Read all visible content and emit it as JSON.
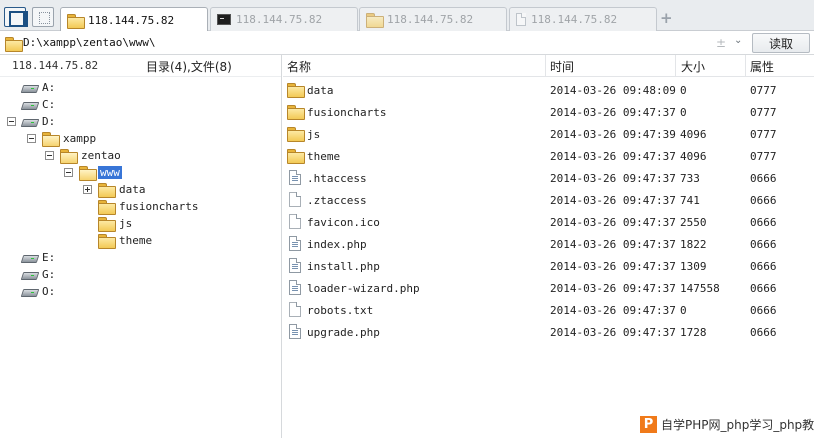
{
  "tabs": [
    {
      "label": "118.144.75.82",
      "icon": "folder-icon",
      "active": true
    },
    {
      "label": "118.144.75.82",
      "icon": "terminal-icon",
      "active": false
    },
    {
      "label": "118.144.75.82",
      "icon": "folder-icon",
      "active": false
    },
    {
      "label": "118.144.75.82",
      "icon": "file-icon",
      "active": false
    }
  ],
  "tab_add": "+",
  "address": {
    "path": "D:\\xampp\\zentao\\www\\",
    "up_glyph": "±",
    "dropdown_glyph": "⌄"
  },
  "read_button": "读取",
  "left": {
    "host": "118.144.75.82",
    "counts": "目录(4),文件(8)",
    "tree": [
      {
        "label": "A:",
        "type": "drive"
      },
      {
        "label": "C:",
        "type": "drive"
      },
      {
        "label": "D:",
        "type": "drive",
        "expanded": true
      },
      {
        "label": "xampp",
        "type": "folder",
        "expanded": true
      },
      {
        "label": "zentao",
        "type": "folder",
        "expanded": true
      },
      {
        "label": "www",
        "type": "folder",
        "expanded": true,
        "selected": true
      },
      {
        "label": "data",
        "type": "folder",
        "expanded": false
      },
      {
        "label": "fusioncharts",
        "type": "folder"
      },
      {
        "label": "js",
        "type": "folder"
      },
      {
        "label": "theme",
        "type": "folder"
      },
      {
        "label": "E:",
        "type": "drive"
      },
      {
        "label": "G:",
        "type": "drive"
      },
      {
        "label": "O:",
        "type": "drive"
      }
    ]
  },
  "columns": {
    "name": "名称",
    "time": "时间",
    "size": "大小",
    "attr": "属性"
  },
  "files": [
    {
      "name": "data",
      "time": "2014-03-26 09:48:09",
      "size": "0",
      "attr": "0777",
      "type": "folder"
    },
    {
      "name": "fusioncharts",
      "time": "2014-03-26 09:47:37",
      "size": "0",
      "attr": "0777",
      "type": "folder"
    },
    {
      "name": "js",
      "time": "2014-03-26 09:47:39",
      "size": "4096",
      "attr": "0777",
      "type": "folder"
    },
    {
      "name": "theme",
      "time": "2014-03-26 09:47:37",
      "size": "4096",
      "attr": "0777",
      "type": "folder"
    },
    {
      "name": ".htaccess",
      "time": "2014-03-26 09:47:37",
      "size": "733",
      "attr": "0666",
      "type": "doc"
    },
    {
      "name": ".ztaccess",
      "time": "2014-03-26 09:47:37",
      "size": "741",
      "attr": "0666",
      "type": "blank"
    },
    {
      "name": "favicon.ico",
      "time": "2014-03-26 09:47:37",
      "size": "2550",
      "attr": "0666",
      "type": "blank"
    },
    {
      "name": "index.php",
      "time": "2014-03-26 09:47:37",
      "size": "1822",
      "attr": "0666",
      "type": "doc"
    },
    {
      "name": "install.php",
      "time": "2014-03-26 09:47:37",
      "size": "1309",
      "attr": "0666",
      "type": "doc"
    },
    {
      "name": "loader-wizard.php",
      "time": "2014-03-26 09:47:37",
      "size": "147558",
      "attr": "0666",
      "type": "doc"
    },
    {
      "name": "robots.txt",
      "time": "2014-03-26 09:47:37",
      "size": "0",
      "attr": "0666",
      "type": "blank"
    },
    {
      "name": "upgrade.php",
      "time": "2014-03-26 09:47:37",
      "size": "1728",
      "attr": "0666",
      "type": "doc"
    }
  ],
  "watermark": {
    "logo": "P",
    "text": "自学PHP网_php学习_php教"
  }
}
